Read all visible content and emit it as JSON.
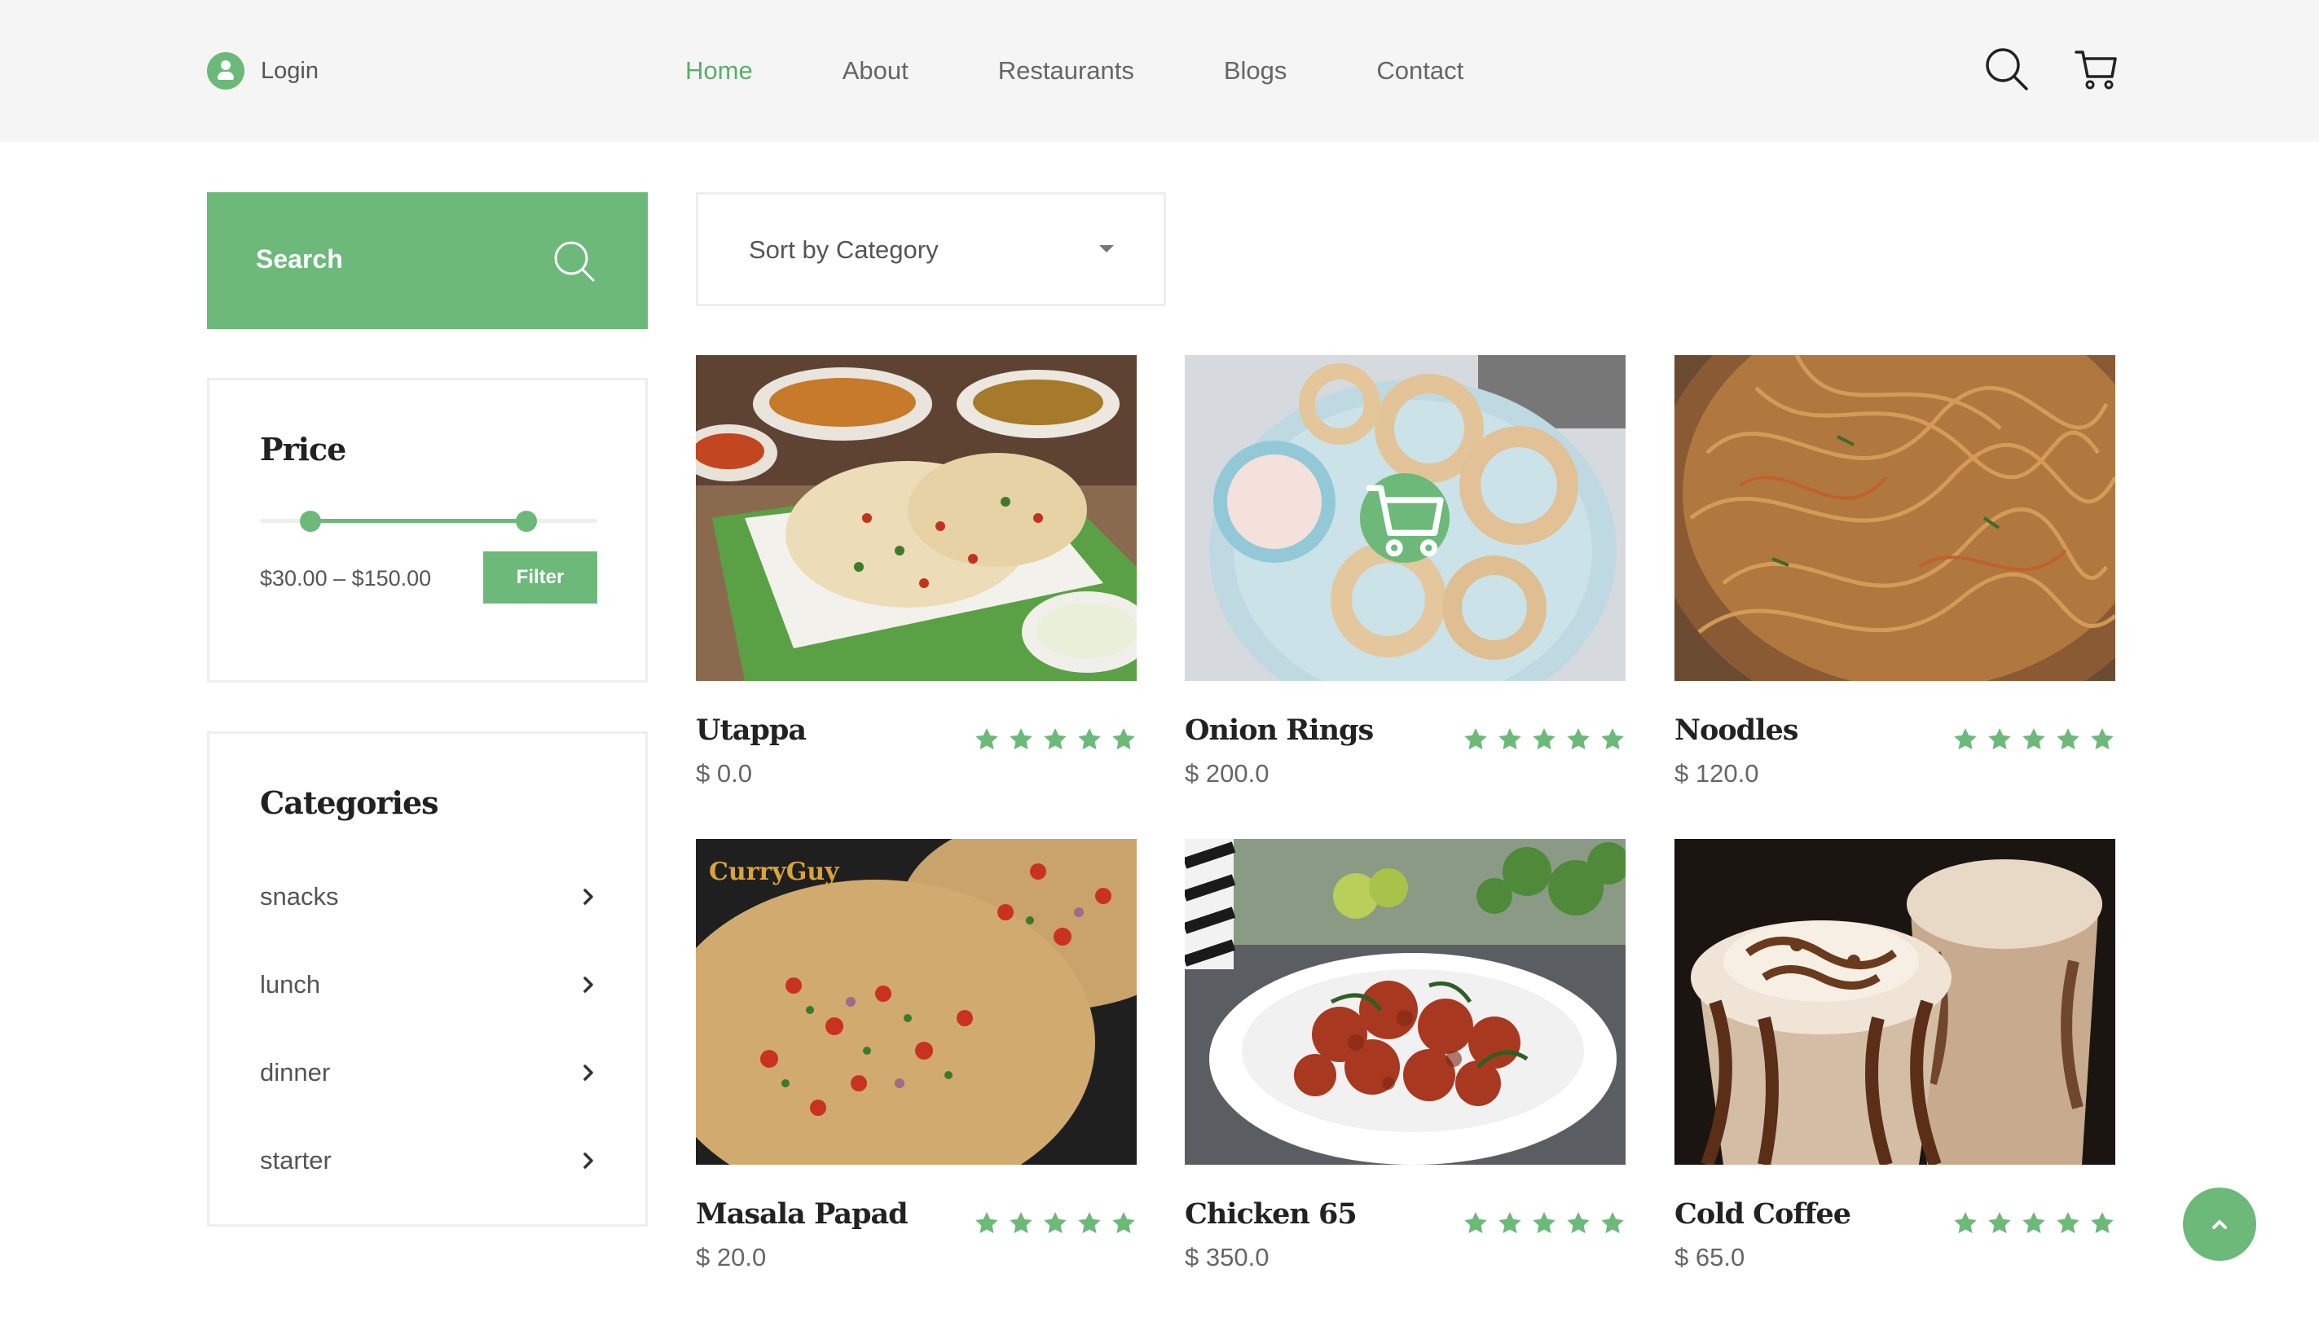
{
  "header": {
    "login_label": "Login",
    "nav": [
      {
        "label": "Home",
        "active": true
      },
      {
        "label": "About",
        "active": false
      },
      {
        "label": "Restaurants",
        "active": false
      },
      {
        "label": "Blogs",
        "active": false
      },
      {
        "label": "Contact",
        "active": false
      }
    ]
  },
  "sidebar": {
    "search_label": "Search",
    "price": {
      "title": "Price",
      "range_text": "$30.00 – $150.00",
      "filter_label": "Filter",
      "min_fraction": 0.15,
      "max_fraction": 0.79
    },
    "categories": {
      "title": "Categories",
      "items": [
        "snacks",
        "lunch",
        "dinner",
        "starter"
      ]
    }
  },
  "sort": {
    "label": "Sort by Category"
  },
  "products": [
    {
      "name": "Utappa",
      "price": "$ 0.0",
      "rating": 5
    },
    {
      "name": "Onion Rings",
      "price": "$ 200.0",
      "rating": 5
    },
    {
      "name": "Noodles",
      "price": "$ 120.0",
      "rating": 5
    },
    {
      "name": "Masala Papad",
      "price": "$ 20.0",
      "rating": 5
    },
    {
      "name": "Chicken 65",
      "price": "$ 350.0",
      "rating": 5
    },
    {
      "name": "Cold Coffee",
      "price": "$ 65.0",
      "rating": 5
    }
  ],
  "image_texts": {
    "masala_papad_logo": "CurryGuy"
  },
  "colors": {
    "accent": "#6cb97a",
    "header_bg": "#f5f5f5",
    "text_dark": "#222222"
  },
  "icons": {
    "login": "user-icon",
    "search": "search-icon",
    "cart": "cart-icon",
    "chevron": "chevron-right-icon",
    "star": "star-icon",
    "to_top": "chevron-up-icon"
  }
}
